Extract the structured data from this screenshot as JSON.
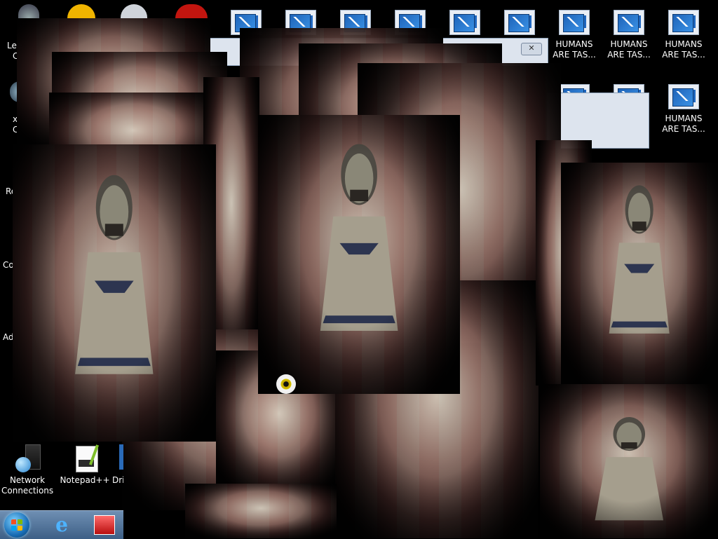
{
  "desktop": {
    "left_fragments": [
      "Lee",
      "C",
      "x",
      "C",
      "Re",
      "Co",
      "Ad"
    ],
    "top_right_icons": [
      {
        "label_line1": "",
        "label_line2": ""
      },
      {
        "label_line1": "",
        "label_line2": ""
      },
      {
        "label_line1": "",
        "label_line2": ""
      },
      {
        "label_line1": "",
        "label_line2": ""
      },
      {
        "label_line1": "",
        "label_line2": ""
      },
      {
        "label_line1": "",
        "label_line2": ""
      },
      {
        "label_line1": "HUMANS",
        "label_line2": "ARE TAS..."
      },
      {
        "label_line1": "HUMANS",
        "label_line2": "ARE TAS..."
      },
      {
        "label_line1": "HUMANS",
        "label_line2": "ARE TAS..."
      }
    ],
    "second_row_icon": {
      "label_line1": "HUMANS",
      "label_line2": "ARE TAS..."
    },
    "bottom_left_icons": [
      {
        "label_line1": "Network",
        "label_line2": "Connections",
        "icon": "network-globe-icon"
      },
      {
        "label_line1": "Notepad++",
        "label_line2": "",
        "icon": "notepad-icon"
      },
      {
        "label_line1": "Dri",
        "label_line2": "",
        "icon": "drive-icon"
      }
    ]
  },
  "dialogs": {
    "close_glyph": "✕"
  },
  "taskbar": {
    "start_icon": "windows-start-orb",
    "pinned": [
      "internet-explorer-icon",
      "app-icon"
    ]
  },
  "colors": {
    "desktop": "#000000",
    "taskbar": "#4f6f95",
    "window_chrome": "#dde4ee"
  }
}
